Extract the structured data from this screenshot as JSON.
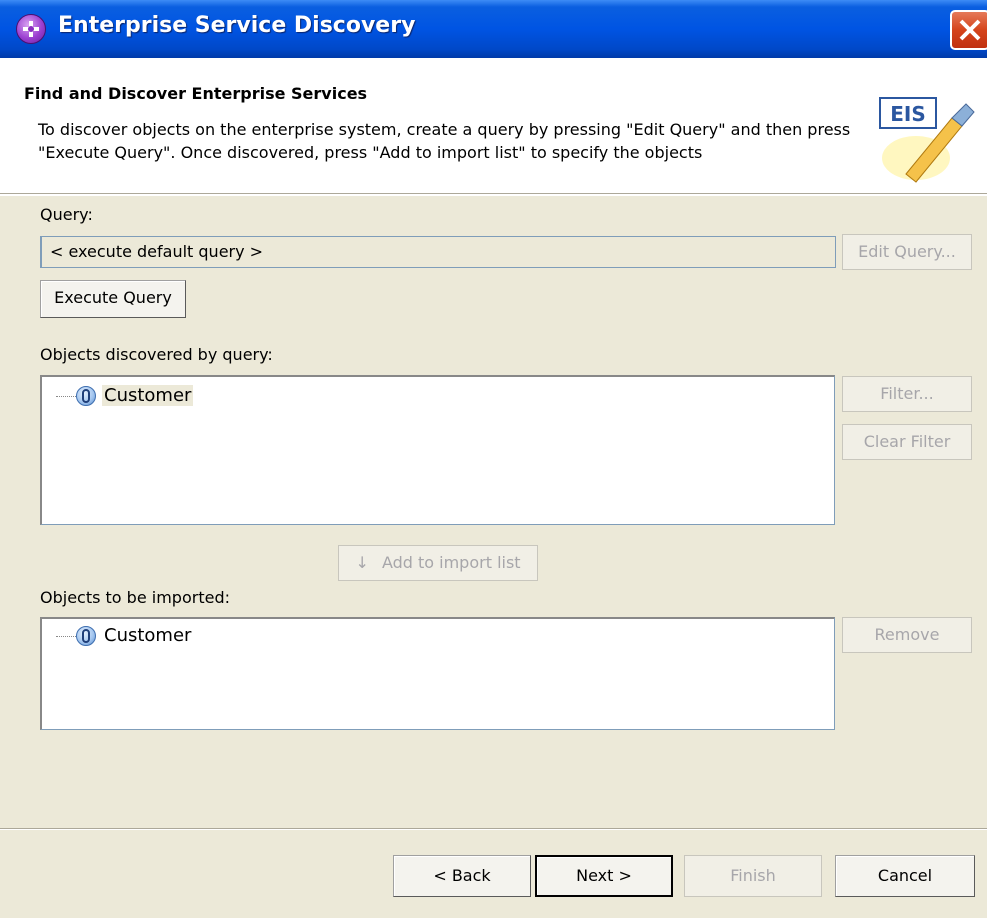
{
  "window": {
    "title": "Enterprise Service Discovery"
  },
  "header": {
    "title": "Find and Discover Enterprise Services",
    "description": "To discover objects on the enterprise system, create a query by pressing \"Edit Query\" and then press \"Execute Query\". Once discovered, press \"Add to import list\" to specify the objects",
    "logo_text": "EIS"
  },
  "query": {
    "label": "Query:",
    "value": "< execute default query >",
    "edit_button": "Edit Query...",
    "execute_button": "Execute Query"
  },
  "discovered": {
    "label": "Objects discovered by query:",
    "items": [
      {
        "label": "Customer",
        "icon": "business-object-icon"
      }
    ],
    "filter_button": "Filter...",
    "clear_filter_button": "Clear Filter"
  },
  "add_button": "Add to import list",
  "add_icon": "↓",
  "imported": {
    "label": "Objects to be imported:",
    "items": [
      {
        "label": "Customer",
        "icon": "business-object-icon"
      }
    ],
    "remove_button": "Remove"
  },
  "footer": {
    "back": "< Back",
    "next": "Next >",
    "finish": "Finish",
    "cancel": "Cancel"
  },
  "colors": {
    "titlebar": "#0054e3",
    "dialog_bg": "#ece9d8",
    "close": "#d5441b"
  }
}
